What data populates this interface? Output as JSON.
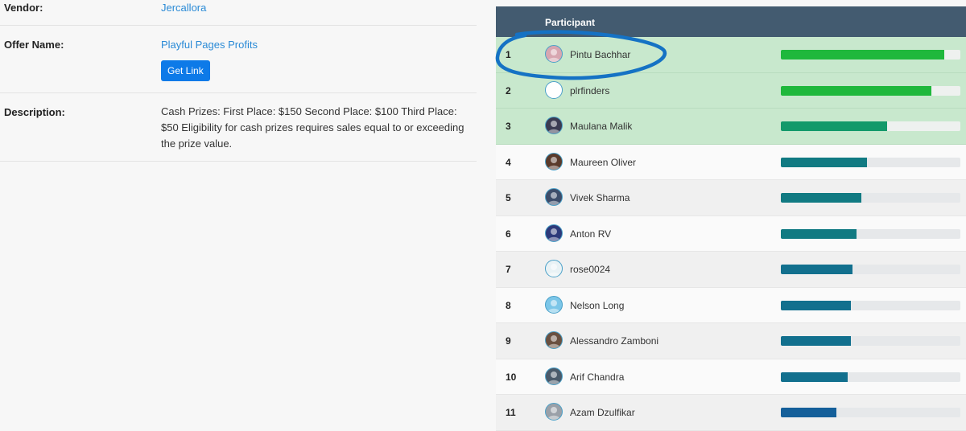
{
  "details": {
    "vendor_label": "Vendor:",
    "vendor_value": "Jercallora",
    "offer_label": "Offer Name:",
    "offer_value": "Playful Pages Profits",
    "get_link_label": "Get Link",
    "description_label": "Description:",
    "description_value": "Cash Prizes: First Place: $150 Second Place: $100 Third Place: $50 Eligibility for cash prizes requires sales equal to or exceeding the prize value."
  },
  "leaderboard": {
    "header": "Participant",
    "rows": [
      {
        "rank": "1",
        "name": "Pintu Bachhar",
        "progress": 0.91,
        "color": "#1fb83c",
        "avatar_color": "#d7a6b0"
      },
      {
        "rank": "2",
        "name": "plrfinders",
        "progress": 0.84,
        "color": "#1fb83c",
        "avatar_color": "#ffffff"
      },
      {
        "rank": "3",
        "name": "Maulana Malik",
        "progress": 0.59,
        "color": "#13996a",
        "avatar_color": "#3b3b52"
      },
      {
        "rank": "4",
        "name": "Maureen Oliver",
        "progress": 0.48,
        "color": "#117a82",
        "avatar_color": "#5a3a2a"
      },
      {
        "rank": "5",
        "name": "Vivek Sharma",
        "progress": 0.45,
        "color": "#117a82",
        "avatar_color": "#3d4d6a"
      },
      {
        "rank": "6",
        "name": "Anton RV",
        "progress": 0.42,
        "color": "#117a82",
        "avatar_color": "#2d3a7a"
      },
      {
        "rank": "7",
        "name": "rose0024",
        "progress": 0.4,
        "color": "#12708e",
        "avatar_color": "#e9f2f5"
      },
      {
        "rank": "8",
        "name": "Nelson Long",
        "progress": 0.39,
        "color": "#12708e",
        "avatar_color": "#7cc6e8"
      },
      {
        "rank": "9",
        "name": "Alessandro Zamboni",
        "progress": 0.39,
        "color": "#12708e",
        "avatar_color": "#6a5040"
      },
      {
        "rank": "10",
        "name": "Arif Chandra",
        "progress": 0.37,
        "color": "#12708e",
        "avatar_color": "#4a5a6a"
      },
      {
        "rank": "11",
        "name": "Azam Dzulfikar",
        "progress": 0.31,
        "color": "#145f9a",
        "avatar_color": "#9aa0a8"
      }
    ]
  }
}
